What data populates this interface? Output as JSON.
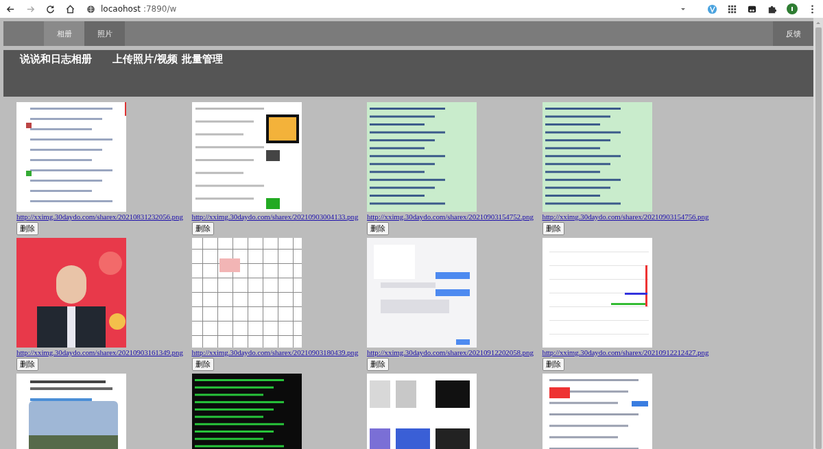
{
  "browser": {
    "address_host": "locaohost",
    "address_path": ":7890/w"
  },
  "nav": {
    "tabs": [
      {
        "label": "相册",
        "selected": true
      },
      {
        "label": "照片",
        "selected": false
      }
    ],
    "feedback": "反馈"
  },
  "header": {
    "links": [
      "说说和日志相册",
      "上传照片/视频 批量管理"
    ]
  },
  "photos": [
    {
      "kind": "picture",
      "url": "http://xximg.30daydo.com/sharex/20210831232056.png",
      "delete": "删除"
    },
    {
      "kind": "picture",
      "url": "http://xximg.30daydo.com/sharex/20210903004133.png",
      "delete": "删除"
    },
    {
      "kind": "picture",
      "url": "http://xximg.30daydo.com/sharex/20210903154752.png",
      "delete": "删除"
    },
    {
      "kind": "picture",
      "url": "http://xximg.30daydo.com/sharex/20210903154756.png",
      "delete": "删除"
    },
    {
      "kind": "picture",
      "url": "http://xximg.30daydo.com/sharex/20210903161349.png",
      "delete": "删除"
    },
    {
      "kind": "picture",
      "url": "http://xximg.30daydo.com/sharex/20210903180439.png",
      "delete": "删除"
    },
    {
      "kind": "picture",
      "url": "http://xximg.30daydo.com/sharex/20210912202058.png",
      "delete": "删除"
    },
    {
      "kind": "picture",
      "url": "http://xximg.30daydo.com/sharex/20210912212427.png",
      "delete": "删除"
    },
    {
      "kind": "picture"
    },
    {
      "kind": "picture"
    },
    {
      "kind": "picture"
    },
    {
      "kind": "picture"
    }
  ]
}
